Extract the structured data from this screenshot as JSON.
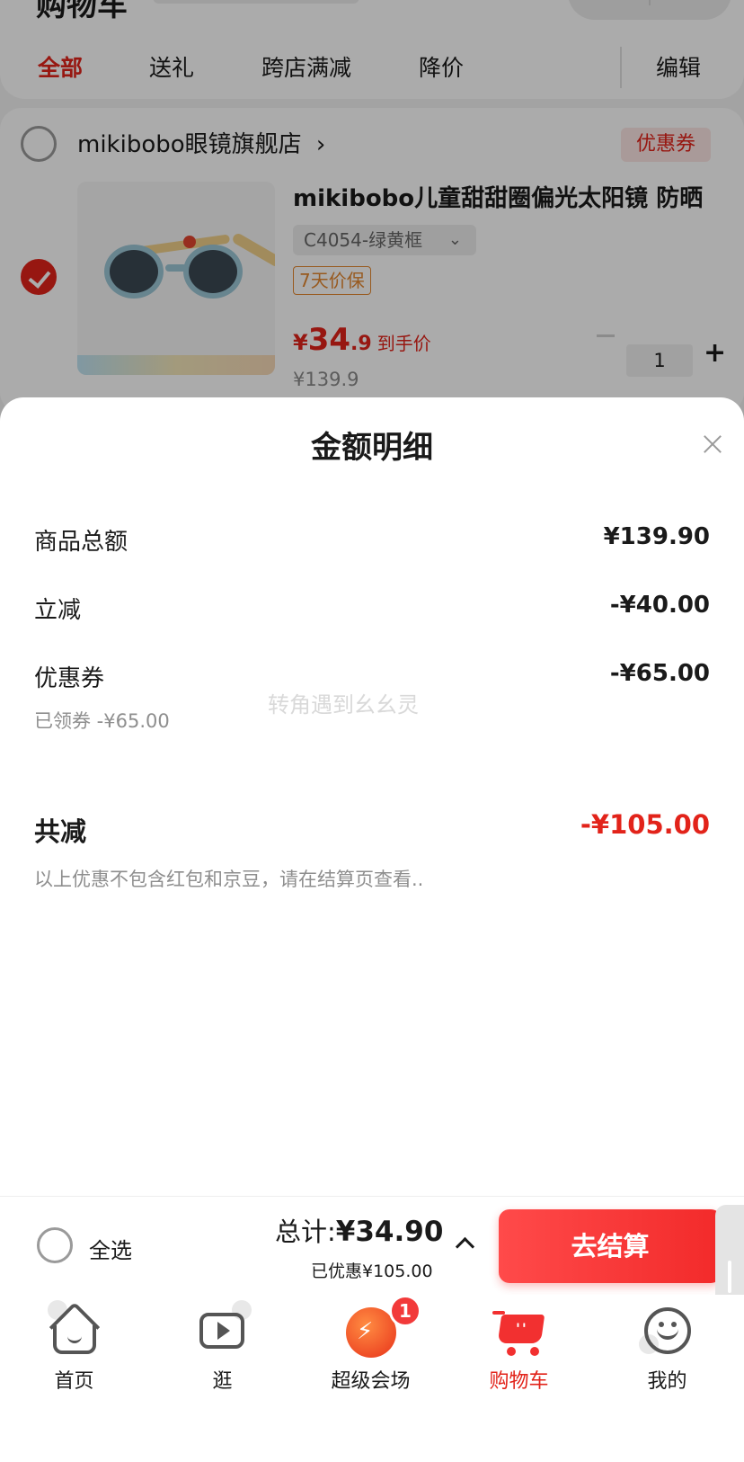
{
  "header": {
    "title": "购物车"
  },
  "filter_tabs": [
    "全部",
    "送礼",
    "跨店满减",
    "降价"
  ],
  "edit_label": "编辑",
  "store": {
    "name": "mikibobo眼镜旗舰店",
    "chevron": "›",
    "coupon_tag": "优惠券"
  },
  "product": {
    "title": "mikibobo儿童甜甜圈偏光太阳镜 防晒",
    "variant": "C4054-绿黄框",
    "variant_chevron": "⌄",
    "guarantee": "7天价保",
    "price_symbol": "¥",
    "price_int": "34",
    "price_dec": ".9",
    "price_note": "到手价",
    "original_price": "¥139.9",
    "quantity": "1",
    "plus": "+",
    "checked": true
  },
  "sheet": {
    "title": "金额明细",
    "rows": [
      {
        "label": "商品总额",
        "value": "¥139.90"
      },
      {
        "label": "立减",
        "value": "-¥40.00"
      },
      {
        "label": "优惠券",
        "value": "-¥65.00",
        "sub": "已领券 -¥65.00"
      }
    ],
    "watermark": "转角遇到幺幺灵",
    "total_label": "共减",
    "total_value": "-¥105.00",
    "disclaimer": "以上优惠不包含红包和京豆，请在结算页查看.."
  },
  "checkout": {
    "select_all": "全选",
    "total_label": "总计:",
    "total_amount": "¥34.90",
    "saved": "已优惠¥105.00",
    "button": "去结算"
  },
  "tab_bar": {
    "items": [
      {
        "label": "首页",
        "icon": "home-icon"
      },
      {
        "label": "逛",
        "icon": "play-icon"
      },
      {
        "label": "超级会场",
        "icon": "event-icon",
        "badge": "1"
      },
      {
        "label": "购物车",
        "icon": "cart-icon",
        "active": true
      },
      {
        "label": "我的",
        "icon": "me-icon"
      }
    ]
  },
  "colors": {
    "accent": "#e2231a",
    "button": "#f23030",
    "muted": "#8e8e8e"
  }
}
